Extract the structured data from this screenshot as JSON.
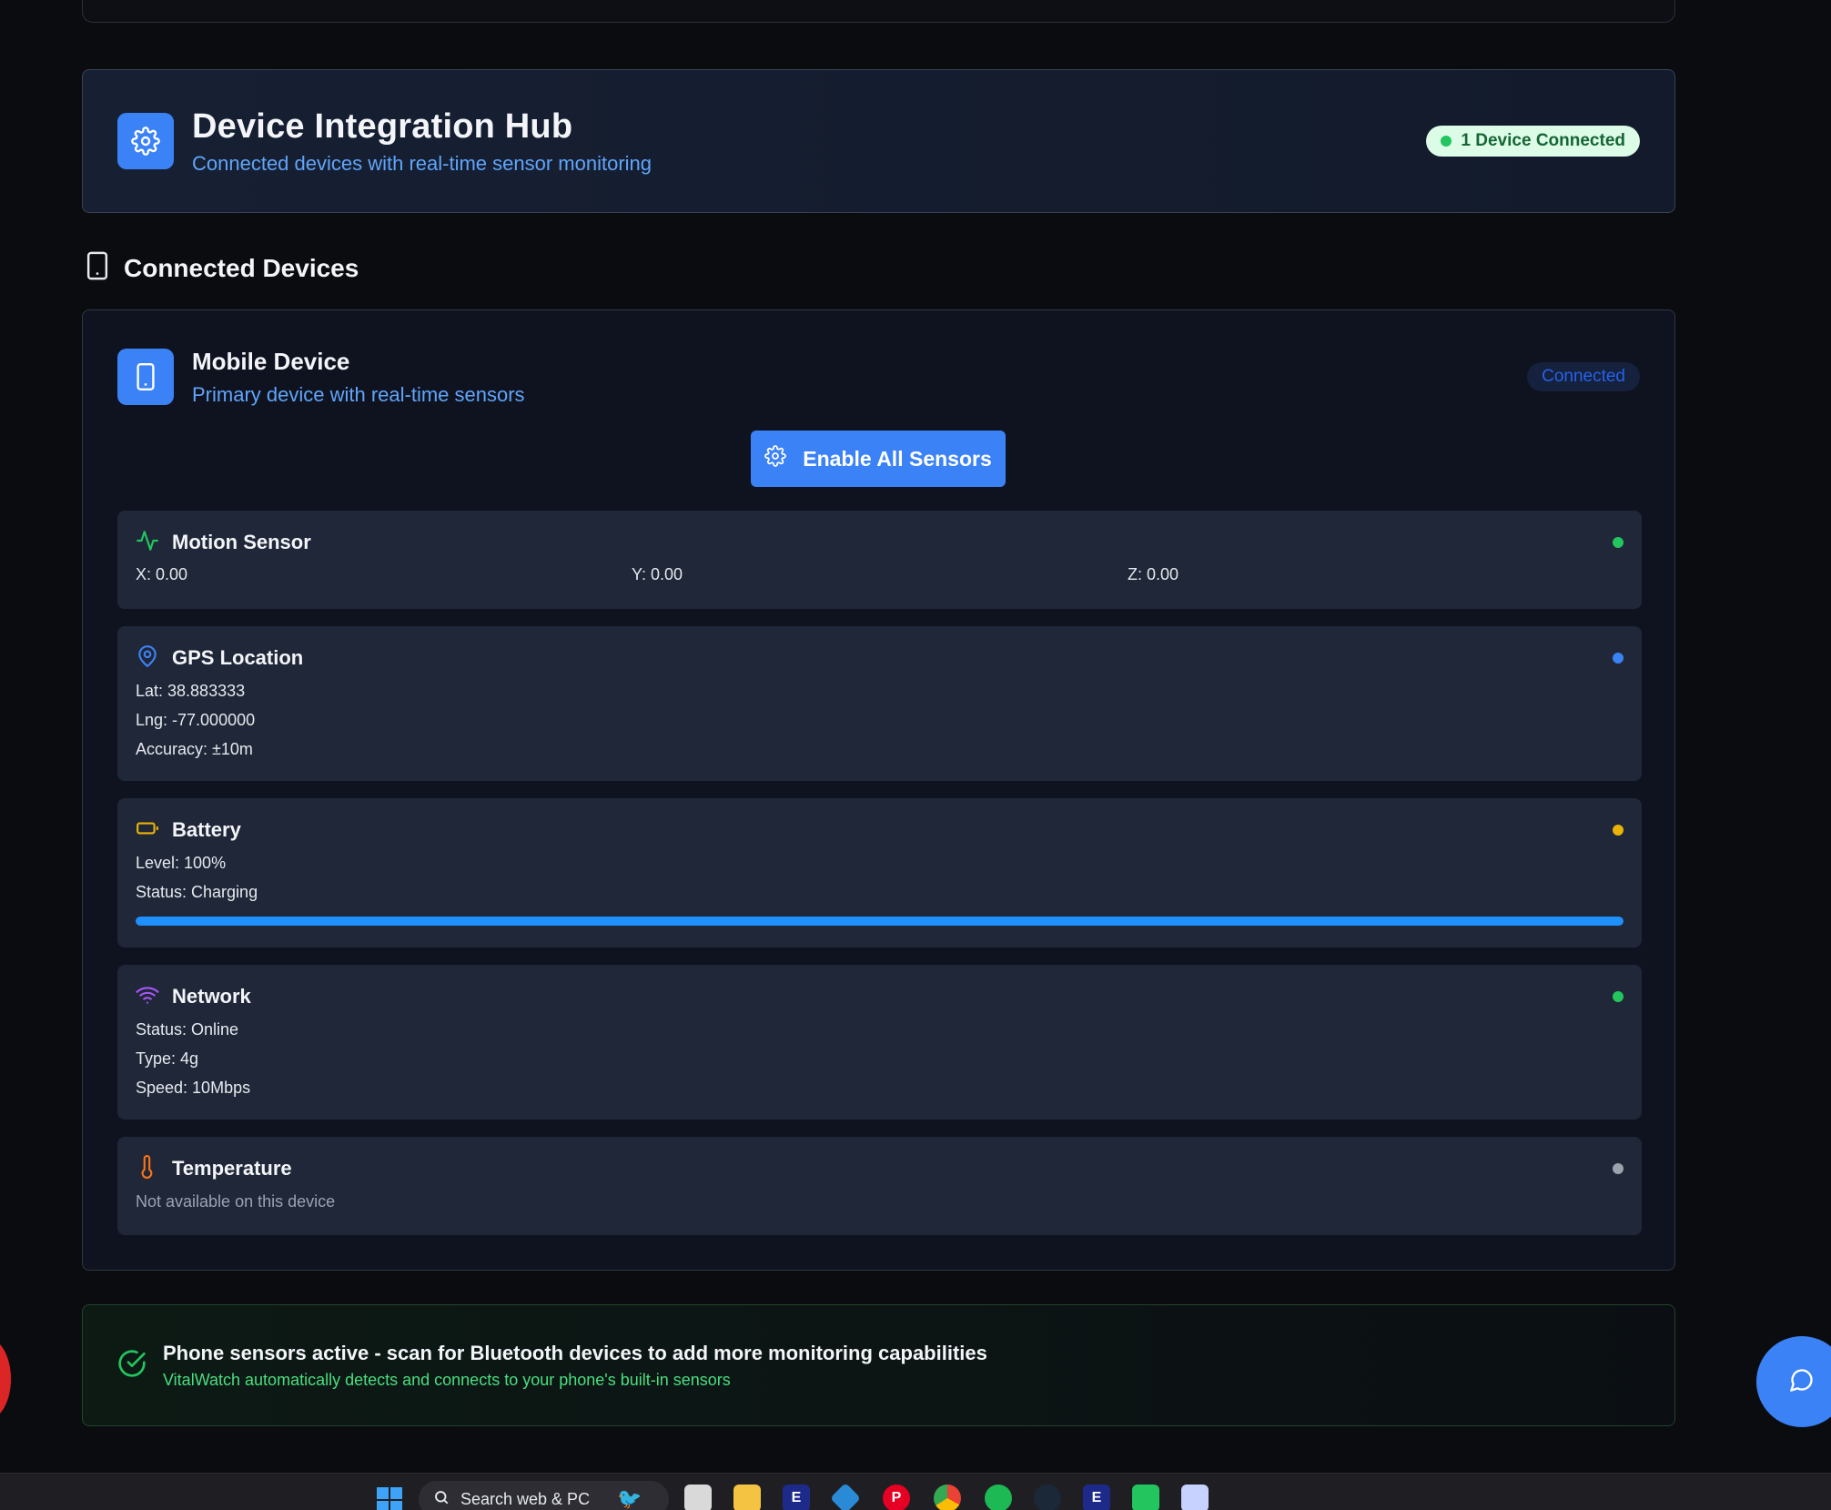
{
  "hub": {
    "title": "Device Integration Hub",
    "subtitle": "Connected devices with real-time sensor monitoring",
    "badge": "1 Device Connected"
  },
  "section": {
    "title": "Connected Devices"
  },
  "device": {
    "name": "Mobile Device",
    "description": "Primary device with real-time sensors",
    "status": "Connected",
    "enable_button": "Enable All Sensors"
  },
  "sensors": {
    "motion": {
      "title": "Motion Sensor",
      "x": "X: 0.00",
      "y": "Y: 0.00",
      "z": "Z: 0.00",
      "dot_color": "#22c55e"
    },
    "gps": {
      "title": "GPS Location",
      "lat": "Lat: 38.883333",
      "lng": "Lng: -77.000000",
      "accuracy": "Accuracy: ±10m",
      "dot_color": "#3b82f6"
    },
    "battery": {
      "title": "Battery",
      "level": "Level: 100%",
      "status": "Status: Charging",
      "level_fraction": 1.0,
      "dot_color": "#eab308"
    },
    "network": {
      "title": "Network",
      "status": "Status: Online",
      "type": "Type: 4g",
      "speed": "Speed: 10Mbps",
      "dot_color": "#22c55e"
    },
    "temperature": {
      "title": "Temperature",
      "note": "Not available on this device",
      "dot_color": "#9ca3af"
    }
  },
  "banner": {
    "title": "Phone sensors active - scan for Bluetooth devices to add more monitoring capabilities",
    "subtitle": "VitalWatch automatically detects and connects to your phone's built-in sensors"
  },
  "taskbar": {
    "search_placeholder": "Search web & PC",
    "icons": [
      "windows-start",
      "search",
      "task-view",
      "file-explorer",
      "app-e",
      "kodi",
      "pinterest",
      "chrome",
      "spotify",
      "steam",
      "app-e2",
      "app-green",
      "app-misc"
    ]
  },
  "colors": {
    "accent": "#3b82f6",
    "success": "#22c55e",
    "background": "#0b0c10"
  }
}
